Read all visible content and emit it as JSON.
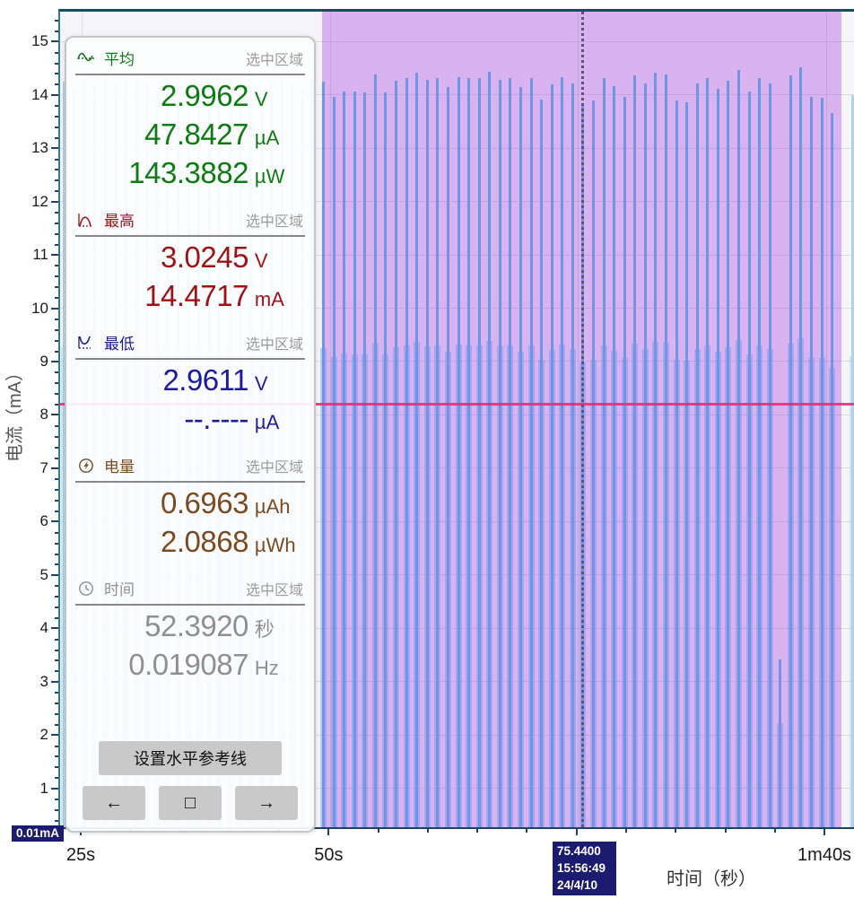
{
  "panel": {
    "sections": [
      {
        "id": "average",
        "label": "平均",
        "scope": "选中区域",
        "color": "#0e7b11",
        "rows": [
          {
            "value": "2.9962",
            "unit": "V"
          },
          {
            "value": "47.8427",
            "unit": "µA"
          },
          {
            "value": "143.3882",
            "unit": "µW"
          }
        ]
      },
      {
        "id": "maximum",
        "label": "最高",
        "scope": "选中区域",
        "color": "#9c1414",
        "rows": [
          {
            "value": "3.0245",
            "unit": "V"
          },
          {
            "value": "14.4717",
            "unit": "mA"
          }
        ]
      },
      {
        "id": "minimum",
        "label": "最低",
        "scope": "选中区域",
        "color": "#1b1b9e",
        "rows": [
          {
            "value": "2.9611",
            "unit": "V"
          },
          {
            "value": "--.----",
            "unit": "µA"
          }
        ]
      },
      {
        "id": "energy",
        "label": "电量",
        "scope": "选中区域",
        "color": "#7b4a1e",
        "rows": [
          {
            "value": "0.6963",
            "unit": "µAh"
          },
          {
            "value": "2.0868",
            "unit": "µWh"
          }
        ]
      },
      {
        "id": "time",
        "label": "时间",
        "scope": "选中区域",
        "color": "#8f8f8f",
        "rows": [
          {
            "value": "52.3920",
            "unit": "秒"
          },
          {
            "value": "0.019087",
            "unit": "Hz"
          }
        ]
      }
    ],
    "buttons": [
      {
        "id": "set-reference-line",
        "label": "设置水平参考线"
      },
      {
        "id": "prev",
        "label": "←"
      },
      {
        "id": "marker-box",
        "label": "□"
      },
      {
        "id": "next",
        "label": "→"
      }
    ]
  },
  "chart_data": {
    "type": "spike-train current waveform (bar/line hybrid)",
    "title": "",
    "xlabel": "时间（秒）",
    "ylabel": "电流（mA）",
    "xlim_s": [
      22.74,
      102.8
    ],
    "ylim_mA": [
      0.27,
      15.56
    ],
    "y_major_ticks": [
      1,
      2,
      3,
      4,
      5,
      6,
      7,
      8,
      9,
      10,
      11,
      12,
      13,
      14,
      15
    ],
    "x_major_ticks": [
      {
        "t": 25,
        "label": "25s"
      },
      {
        "t": 50,
        "label": "50s"
      },
      {
        "t": 75,
        "label": ""
      },
      {
        "t": 100,
        "label": "1m40s"
      }
    ],
    "grid": true,
    "selection_s": [
      49.17,
      101.55
    ],
    "selection_duration_s": 52.392,
    "reference_line_mA": 8.2,
    "cursor": {
      "t_s": 75.44,
      "label_time": "75.4400",
      "label_clock": "15:56:49",
      "label_date": "24/4/10"
    },
    "current_range_badge": "0.01mA",
    "spikes": {
      "t_start_s": 23.12,
      "period_s": 1.047,
      "baseline_mA": 0.05,
      "peaks_mA": [
        14.25,
        14.12,
        14.32,
        14.2,
        14.36,
        14.15,
        14.28,
        14.4,
        14.22,
        14.1,
        14.3,
        14.24,
        14.18,
        14.35,
        14.26,
        14.12,
        14.3,
        14.2,
        14.38,
        14.16,
        14.27,
        14.33,
        14.21,
        14.12,
        14.3,
        14.24,
        13.97,
        14.07,
        14.06,
        14.05,
        14.39,
        14.05,
        14.26,
        14.31,
        14.41,
        14.28,
        14.32,
        14.14,
        14.34,
        14.32,
        14.31,
        14.44,
        14.29,
        14.31,
        14.14,
        14.32,
        13.91,
        14.19,
        14.34,
        14.21,
        13.82,
        13.9,
        14.31,
        14.16,
        13.96,
        14.36,
        14.21,
        14.41,
        14.39,
        13.9,
        13.86,
        14.21,
        14.31,
        14.12,
        14.26,
        14.46,
        14.06,
        14.31,
        14.21,
        3.42,
        14.36,
        14.52,
        13.96,
        13.94,
        13.66,
        null,
        14.0
      ]
    },
    "colors": {
      "plot_bg": "#f5f4f6",
      "selection_bg": "#d9b2f0",
      "spike_selected": "#6e95ea",
      "spike_unselected": "#a9d3f3",
      "reference_line": "#e8297c",
      "cursor_line": "#5d5472",
      "badge_bg": "#1b1b70",
      "border_teal": "#134f61",
      "axis_navy": "#1c4266"
    },
    "legend": null
  }
}
